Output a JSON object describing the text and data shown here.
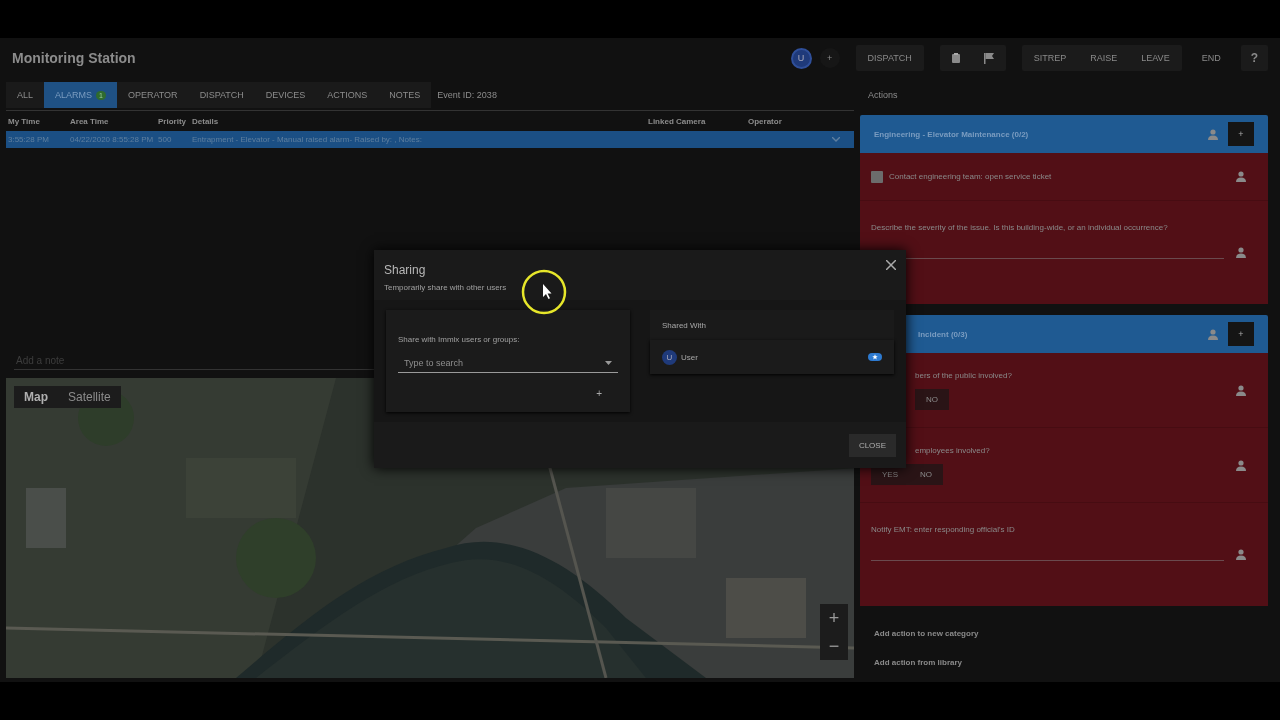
{
  "window": {
    "title": "Monitoring Station"
  },
  "toolbar": {
    "avatar": "U",
    "add": "+",
    "dispatch": "DISPATCH",
    "actions": [
      "SITREP",
      "RAISE",
      "LEAVE"
    ],
    "end": "END",
    "help": "?"
  },
  "tabs": [
    {
      "label": "ALL",
      "selected": false
    },
    {
      "label": "ALARMS",
      "badge": "1",
      "selected": true
    },
    {
      "label": "OPERATOR",
      "selected": false
    },
    {
      "label": "DISPATCH",
      "selected": false
    },
    {
      "label": "DEVICES",
      "selected": false
    },
    {
      "label": "ACTIONS",
      "selected": false
    },
    {
      "label": "NOTES",
      "selected": false
    }
  ],
  "event_id": "Event ID: 2038",
  "table": {
    "columns": [
      "My Time",
      "Area Time",
      "Priority",
      "Details",
      "Linked Camera",
      "Operator"
    ],
    "rows": [
      {
        "cells": [
          "3:55:28 PM",
          "04/22/2020 8:55:28 PM",
          "500",
          "Entrapment - Elevator - Manual raised alarm- Raised by: , Notes:",
          "",
          ""
        ],
        "selected": true
      }
    ]
  },
  "note": {
    "placeholder": "Add a note"
  },
  "map": {
    "kind": "picture",
    "types": [
      {
        "label": "Map",
        "selected": true
      },
      {
        "label": "Satellite",
        "selected": false
      }
    ],
    "zoom_in": "+",
    "zoom_out": "−"
  },
  "actions": {
    "title": "Actions",
    "categories": [
      {
        "title": "Engineering - Elevator Maintenance (0/2)",
        "add": "+",
        "items": [
          {
            "kind": "check",
            "label": "Contact engineering team: open service ticket",
            "checked": false
          },
          {
            "kind": "text",
            "label": "Describe the severity of the issue. Is this building-wide, or an individual occurrence?"
          }
        ]
      },
      {
        "title": "Incident (0/3)",
        "add": "+",
        "items": [
          {
            "kind": "yesno",
            "label": "bers of the public involved?",
            "options": [
              "NO"
            ]
          },
          {
            "kind": "yesno",
            "label": "employees involved?",
            "options": [
              "YES",
              "NO"
            ]
          },
          {
            "kind": "text",
            "label": "Notify EMT: enter responding official's ID"
          }
        ]
      }
    ],
    "links": [
      "Add action to new category",
      "Add action from library"
    ]
  },
  "dialog": {
    "title": "Sharing",
    "subtitle": "Temporarily share with other users",
    "share_label": "Share with Immix users or groups:",
    "search": {
      "placeholder": "Type to search"
    },
    "add": "+",
    "shared_with": {
      "title": "Shared With",
      "users": [
        {
          "avatar": "U",
          "name": "User"
        }
      ]
    },
    "close": "CLOSE"
  }
}
